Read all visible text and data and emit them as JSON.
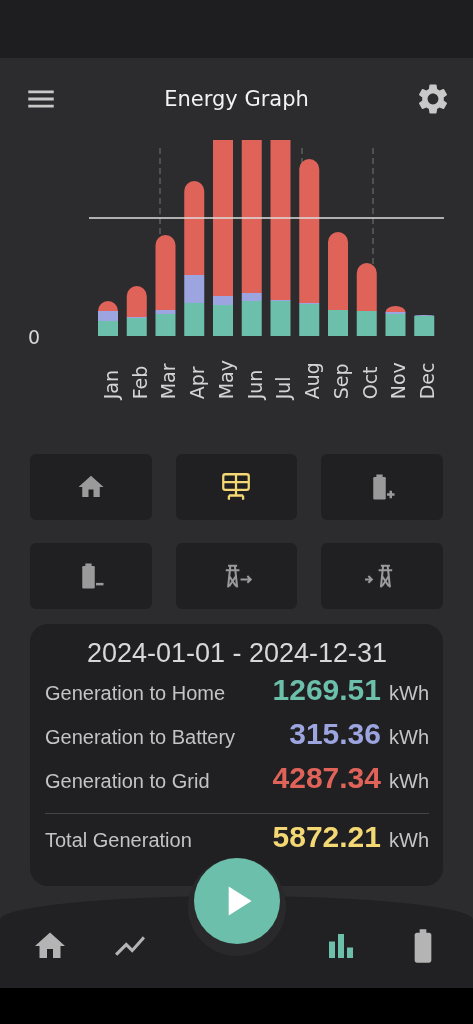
{
  "header": {
    "title": "Energy Graph"
  },
  "chart": {
    "y_axis_label": "0",
    "months": [
      "Jan",
      "Feb",
      "Mar",
      "Apr",
      "May",
      "Jun",
      "Jul",
      "Aug",
      "Sep",
      "Oct",
      "Nov",
      "Dec"
    ]
  },
  "filters": [
    {
      "kind": "home",
      "selected": false
    },
    {
      "kind": "solar",
      "selected": true
    },
    {
      "kind": "battery_charge",
      "selected": false
    },
    {
      "kind": "battery_discharge",
      "selected": false
    },
    {
      "kind": "grid_export",
      "selected": false
    },
    {
      "kind": "grid_import",
      "selected": false
    }
  ],
  "summary": {
    "period": "2024-01-01 - 2024-12-31",
    "rows": [
      {
        "label": "Generation to Home",
        "value": "1269.51",
        "unit": "kWh",
        "color": "#6cbfaa"
      },
      {
        "label": "Generation to Battery",
        "value": "315.36",
        "unit": "kWh",
        "color": "#9ca5e0"
      },
      {
        "label": "Generation to Grid",
        "value": "4287.34",
        "unit": "kWh",
        "color": "#e0635a"
      }
    ],
    "total": {
      "label": "Total Generation",
      "value": "5872.21",
      "unit": "kWh",
      "color": "#f3d874"
    }
  },
  "nav": [
    {
      "kind": "home",
      "selected": false
    },
    {
      "kind": "trend",
      "selected": false
    },
    {
      "kind": "play",
      "selected": false
    },
    {
      "kind": "chart",
      "selected": true
    },
    {
      "kind": "battery",
      "selected": false
    }
  ]
}
